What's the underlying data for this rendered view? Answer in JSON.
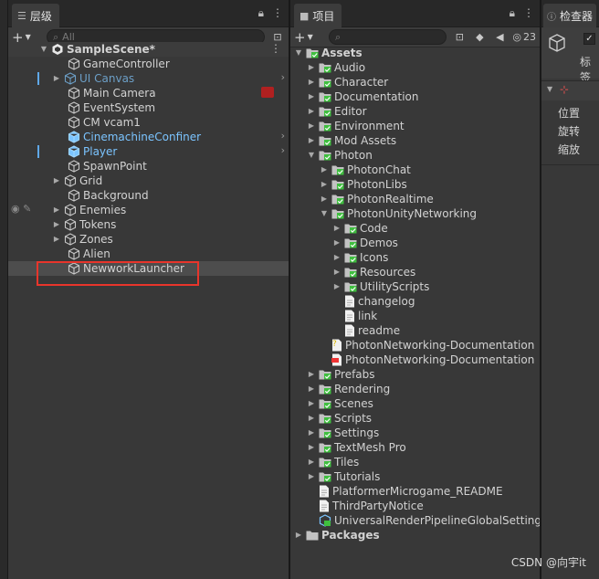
{
  "hierarchy": {
    "tab_label": "层级",
    "search_placeholder": "All",
    "scene_name": "SampleScene*",
    "items": [
      {
        "label": "GameController"
      },
      {
        "label": "UI Canvas"
      },
      {
        "label": "Main Camera"
      },
      {
        "label": "EventSystem"
      },
      {
        "label": "CM vcam1"
      },
      {
        "label": "CinemachineConfiner"
      },
      {
        "label": "Player"
      },
      {
        "label": "SpawnPoint"
      },
      {
        "label": "Grid"
      },
      {
        "label": "Background"
      },
      {
        "label": "Enemies"
      },
      {
        "label": "Tokens"
      },
      {
        "label": "Zones"
      },
      {
        "label": "Alien"
      },
      {
        "label": "NewworkLauncher"
      }
    ]
  },
  "project": {
    "tab_label": "项目",
    "hidden_count": "23",
    "items": [
      {
        "label": "Assets"
      },
      {
        "label": "Audio"
      },
      {
        "label": "Character"
      },
      {
        "label": "Documentation"
      },
      {
        "label": "Editor"
      },
      {
        "label": "Environment"
      },
      {
        "label": "Mod Assets"
      },
      {
        "label": "Photon"
      },
      {
        "label": "PhotonChat"
      },
      {
        "label": "PhotonLibs"
      },
      {
        "label": "PhotonRealtime"
      },
      {
        "label": "PhotonUnityNetworking"
      },
      {
        "label": "Code"
      },
      {
        "label": "Demos"
      },
      {
        "label": "Icons"
      },
      {
        "label": "Resources"
      },
      {
        "label": "UtilityScripts"
      },
      {
        "label": "changelog"
      },
      {
        "label": "link"
      },
      {
        "label": "readme"
      },
      {
        "label": "PhotonNetworking-Documentation"
      },
      {
        "label": "PhotonNetworking-Documentation"
      },
      {
        "label": "Prefabs"
      },
      {
        "label": "Rendering"
      },
      {
        "label": "Scenes"
      },
      {
        "label": "Scripts"
      },
      {
        "label": "Settings"
      },
      {
        "label": "TextMesh Pro"
      },
      {
        "label": "Tiles"
      },
      {
        "label": "Tutorials"
      },
      {
        "label": "PlatformerMicrogame_README"
      },
      {
        "label": "ThirdPartyNotice"
      },
      {
        "label": "UniversalRenderPipelineGlobalSettings"
      },
      {
        "label": "Packages"
      }
    ]
  },
  "inspector": {
    "tab_label": "检查器",
    "tag_label": "标签",
    "position_label": "位置",
    "rotation_label": "旋转",
    "scale_label": "缩放"
  },
  "watermark": "CSDN @向宇it",
  "colors": {
    "accent_red": "#e8352b",
    "prefab_blue": "#7bc4ff",
    "vcs_green": "#3fbf3f"
  }
}
